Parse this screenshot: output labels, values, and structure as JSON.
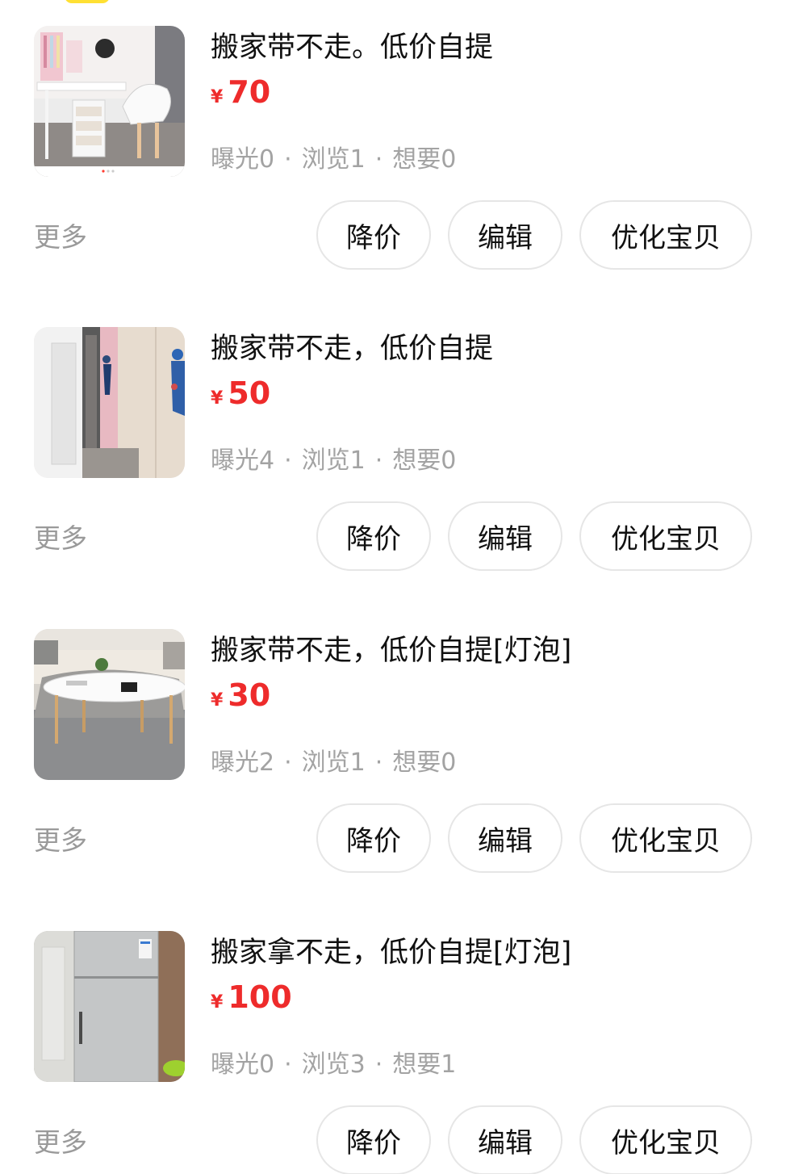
{
  "listings": [
    {
      "title": "搬家带不走。低价自提",
      "currency": "¥",
      "price": "70",
      "exposure": "曝光0",
      "views": "浏览1",
      "wants": "想要0",
      "more": "更多",
      "actions": {
        "reduce": "降价",
        "edit": "编辑",
        "optimize": "优化宝贝"
      },
      "image": "desk-chair-photo"
    },
    {
      "title": "搬家带不走，低价自提",
      "currency": "¥",
      "price": "50",
      "exposure": "曝光4",
      "views": "浏览1",
      "wants": "想要0",
      "more": "更多",
      "actions": {
        "reduce": "降价",
        "edit": "编辑",
        "optimize": "优化宝贝"
      },
      "image": "door-mirror-photo"
    },
    {
      "title": "搬家带不走，低价自提[灯泡]",
      "currency": "¥",
      "price": "30",
      "exposure": "曝光2",
      "views": "浏览1",
      "wants": "想要0",
      "more": "更多",
      "actions": {
        "reduce": "降价",
        "edit": "编辑",
        "optimize": "优化宝贝"
      },
      "image": "coffee-table-photo"
    },
    {
      "title": "搬家拿不走，低价自提[灯泡]",
      "currency": "¥",
      "price": "100",
      "exposure": "曝光0",
      "views": "浏览3",
      "wants": "想要1",
      "more": "更多",
      "actions": {
        "reduce": "降价",
        "edit": "编辑",
        "optimize": "优化宝贝"
      },
      "image": "refrigerator-photo"
    }
  ],
  "separator": "·",
  "colors": {
    "price": "#ee2b2b",
    "stats": "#a3a3a3",
    "more": "#9a9a9a",
    "button_border": "#e6e6e6",
    "accent_yellow": "#ffe033"
  }
}
